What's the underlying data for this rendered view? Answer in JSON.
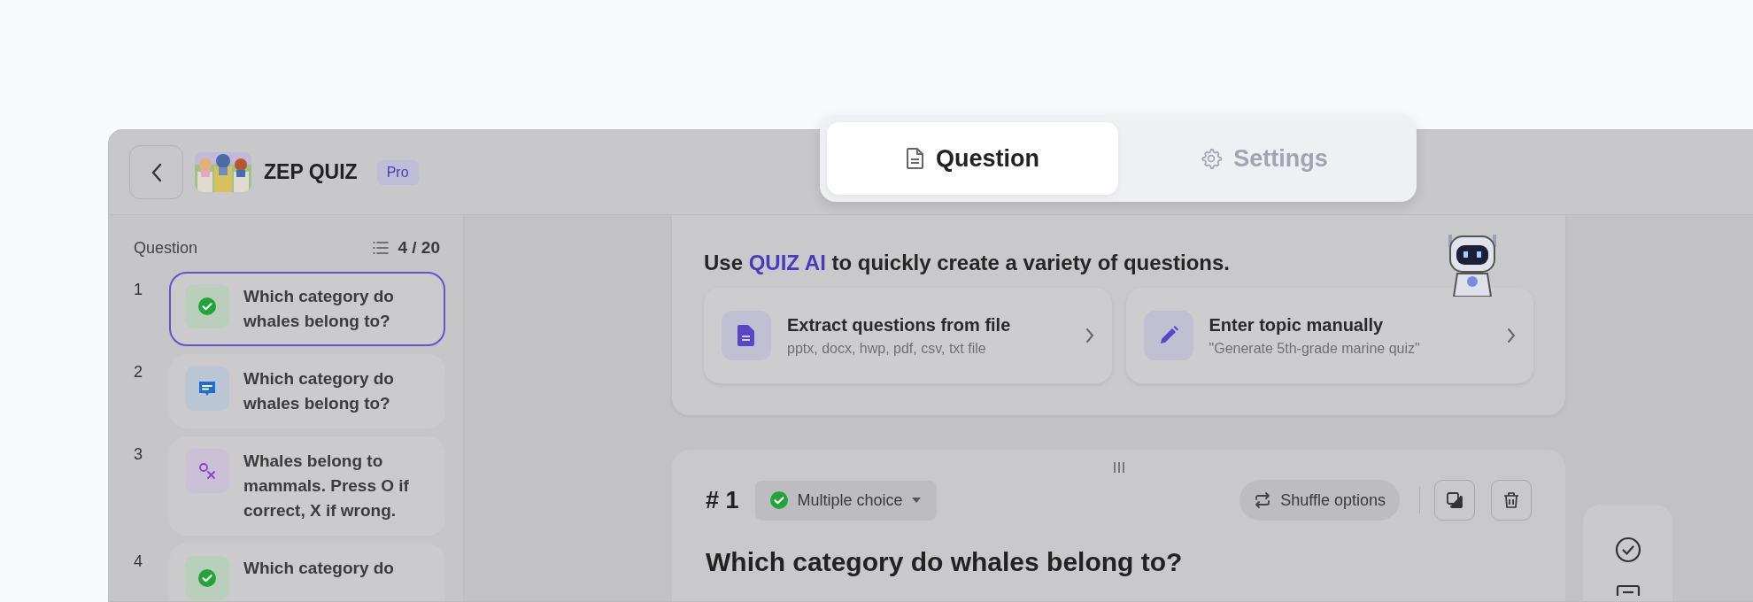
{
  "tabs": [
    {
      "label": "Question",
      "kind": "document",
      "selected": true
    },
    {
      "label": "Settings",
      "kind": "gear",
      "selected": false
    }
  ],
  "header": {
    "title": "ZEP QUIZ",
    "badge": "Pro"
  },
  "sidebar": {
    "title": "Question",
    "count": "4 / 20",
    "items": [
      {
        "number": "1",
        "kind": "multiple_choice",
        "text": "Which category do whales belong to?",
        "selected": true
      },
      {
        "number": "2",
        "kind": "short_answer",
        "text": "Which category do whales belong to?",
        "selected": false
      },
      {
        "number": "3",
        "kind": "ox",
        "text": "Whales belong to mammals. Press O if correct, X if wrong.",
        "selected": false
      },
      {
        "number": "4",
        "kind": "multiple_choice",
        "text": "Which category do",
        "selected": false
      }
    ]
  },
  "ai_panel": {
    "before": "Use",
    "highlight": "QUIZ AI",
    "after": "to quickly create a variety of questions.",
    "options": [
      {
        "kind": "file",
        "title": "Extract questions from file",
        "subtitle": "pptx, docx, hwp, pdf, csv, txt file"
      },
      {
        "kind": "manual",
        "title": "Enter topic manually",
        "subtitle": "\"Generate 5th-grade marine quiz\""
      }
    ]
  },
  "question": {
    "number": "# 1",
    "type": "Multiple choice",
    "kind": "multiple_choice",
    "shuffle": "Shuffle options",
    "title": "Which category do whales belong to?"
  }
}
